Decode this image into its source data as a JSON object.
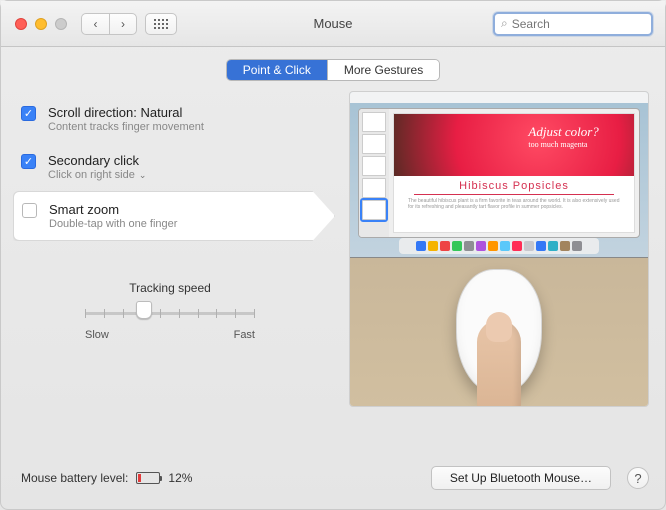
{
  "window": {
    "title": "Mouse"
  },
  "search": {
    "placeholder": "Search"
  },
  "tabs": {
    "point_click": "Point & Click",
    "more_gestures": "More Gestures"
  },
  "options": {
    "scroll": {
      "title": "Scroll direction: Natural",
      "sub": "Content tracks finger movement",
      "checked": true
    },
    "secondary": {
      "title": "Secondary click",
      "sub": "Click on right side",
      "checked": true
    },
    "smartzoom": {
      "title": "Smart zoom",
      "sub": "Double-tap with one finger",
      "checked": false
    }
  },
  "slider": {
    "label": "Tracking speed",
    "min_label": "Slow",
    "max_label": "Fast",
    "ticks": 10,
    "value": 4
  },
  "preview": {
    "hero_line1": "Adjust color?",
    "hero_line2": "too much magenta",
    "doc_title": "Hibiscus Popsicles",
    "blurb": "The beautiful hibiscus plant is a firm favorite in teas around the world. It is also extensively used for its refreshing and pleasantly tart flavor profile in summer popsicles."
  },
  "footer": {
    "battery_label": "Mouse battery level:",
    "battery_percent": "12%",
    "bluetooth_button": "Set Up Bluetooth Mouse…",
    "help": "?"
  },
  "colors": {
    "accent": "#3a82f7"
  }
}
